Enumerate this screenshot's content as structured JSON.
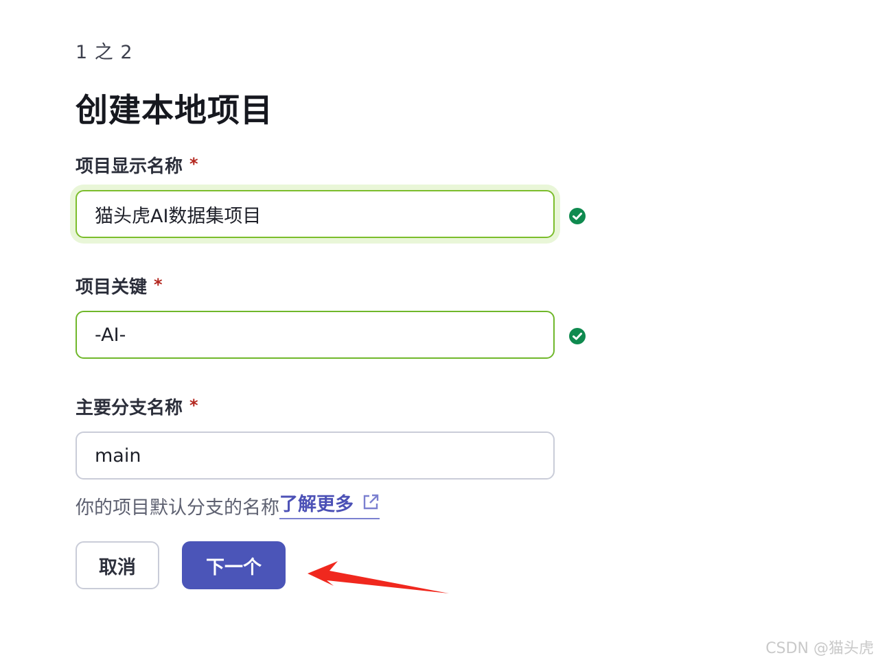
{
  "header": {
    "step": "1 之 2",
    "title": "创建本地项目"
  },
  "form": {
    "display_name": {
      "label": "项目显示名称",
      "required_mark": "*",
      "value": "猫头虎AI数据集项目",
      "status_icon": "check-circle-icon"
    },
    "project_key": {
      "label": "项目关键",
      "required_mark": "*",
      "value": "-AI-",
      "status_icon": "check-circle-icon"
    },
    "main_branch": {
      "label": "主要分支名称",
      "required_mark": "*",
      "value": "main",
      "helper_text": "你的项目默认分支的名称",
      "learn_more": "了解更多",
      "learn_more_icon": "external-link-icon"
    }
  },
  "actions": {
    "cancel_label": "取消",
    "next_label": "下一个"
  },
  "watermark": "CSDN @猫头虎",
  "colors": {
    "primary": "#4b55b8",
    "success": "#0f8a4f",
    "valid_border": "#6fb72a",
    "required": "#b3261e",
    "annotation_arrow": "#f0281e"
  }
}
